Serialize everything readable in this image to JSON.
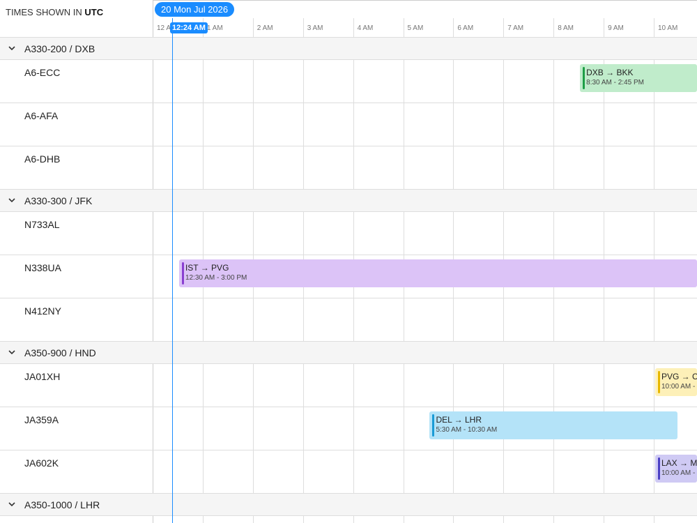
{
  "header": {
    "timezone_prefix": "TIMES SHOWN IN",
    "timezone": "UTC",
    "date": "20 Mon Jul 2026",
    "now_label": "12:24 AM"
  },
  "ticks": [
    "12 AM",
    "1 AM",
    "2 AM",
    "3 AM",
    "4 AM",
    "5 AM",
    "6 AM",
    "7 AM",
    "8 AM",
    "9 AM",
    "10 AM"
  ],
  "groups": [
    {
      "label": "A330-200 / DXB",
      "rows": [
        {
          "label": "A6-ECC",
          "event": {
            "title": "DXB → BKK",
            "time": "8:30 AM - 2:45 PM",
            "color": "green"
          }
        },
        {
          "label": "A6-AFA"
        },
        {
          "label": "A6-DHB"
        }
      ]
    },
    {
      "label": "A330-300 / JFK",
      "rows": [
        {
          "label": "N733AL"
        },
        {
          "label": "N338UA",
          "event": {
            "title": "IST → PVG",
            "time": "12:30 AM - 3:00 PM",
            "color": "purple"
          }
        },
        {
          "label": "N412NY"
        }
      ]
    },
    {
      "label": "A350-900 / HND",
      "rows": [
        {
          "label": "JA01XH",
          "event": {
            "title": "PVG → CD",
            "time": "10:00 AM -",
            "color": "yellow"
          }
        },
        {
          "label": "JA359A",
          "event": {
            "title": "DEL → LHR",
            "time": "5:30 AM - 10:30 AM",
            "color": "blue"
          }
        },
        {
          "label": "JA602K",
          "event": {
            "title": "LAX → MI",
            "time": "10:00 AM -",
            "color": "indigo"
          }
        }
      ]
    },
    {
      "label": "A350-1000 / LHR",
      "rows": []
    }
  ],
  "colors": {
    "green": {
      "bg": "#c0eccb",
      "bar": "#1e9e46"
    },
    "purple": {
      "bg": "#dcc3f7",
      "bar": "#8a3fd1"
    },
    "yellow": {
      "bg": "#fdf0b8",
      "bar": "#e8b800"
    },
    "blue": {
      "bg": "#b4e3f8",
      "bar": "#1a9bd6"
    },
    "indigo": {
      "bg": "#cfcaf4",
      "bar": "#4a3fc4"
    },
    "accent": "#1a8cff"
  }
}
